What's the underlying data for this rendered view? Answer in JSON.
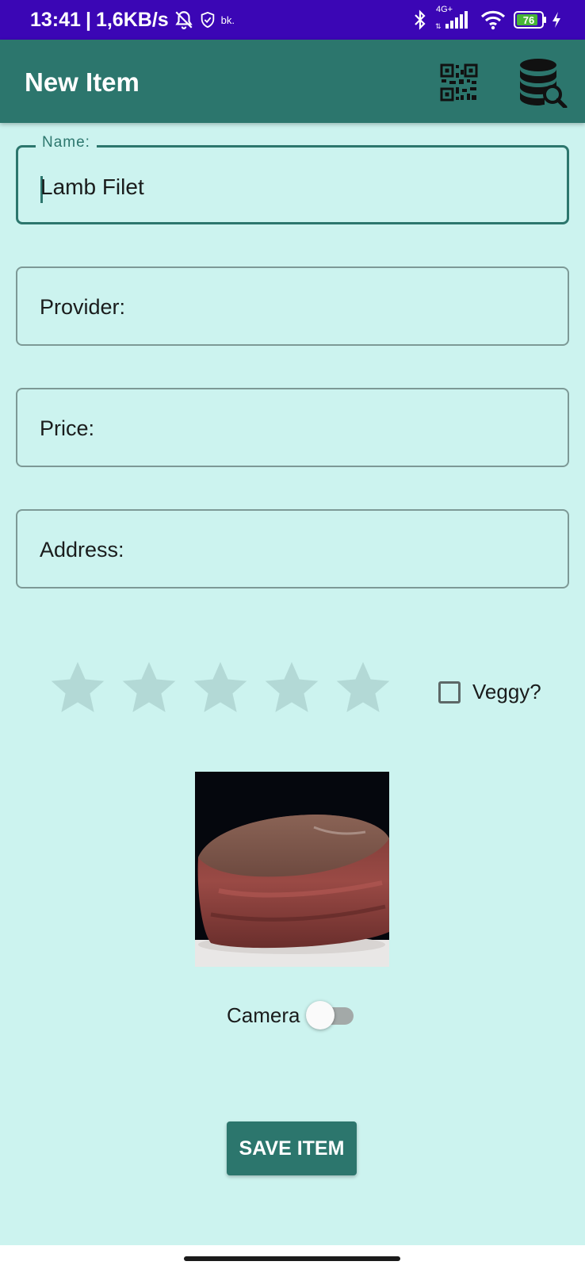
{
  "status_bar": {
    "time": "13:41",
    "separator": "|",
    "net_speed": "1,6KB/s",
    "carrier_small": "bk.",
    "network_type": "4G+",
    "battery_level": "76",
    "icons": [
      "bell-off-icon",
      "shield-icon",
      "bluetooth-icon",
      "signal-icon",
      "wifi-icon",
      "battery-icon",
      "charging-icon"
    ]
  },
  "app_bar": {
    "title": "New Item",
    "actions": [
      "qr-code-icon",
      "database-search-icon"
    ]
  },
  "form": {
    "name": {
      "label": "Name:",
      "value": "Lamb Filet"
    },
    "provider": {
      "label": "Provider:"
    },
    "price": {
      "label": "Price:"
    },
    "address": {
      "label": "Address:"
    }
  },
  "rating": {
    "max": 5,
    "value": 0
  },
  "veggy": {
    "label": "Veggy?",
    "checked": false
  },
  "photo": {
    "subject": "lamb filet steak"
  },
  "camera": {
    "label": "Camera",
    "enabled": false
  },
  "save_button": {
    "label": "SAVE ITEM"
  },
  "colors": {
    "background": "#ccf3ef",
    "primary": "#2c766d",
    "status_bar": "#3b06b5",
    "star": "#b3d9d6"
  }
}
